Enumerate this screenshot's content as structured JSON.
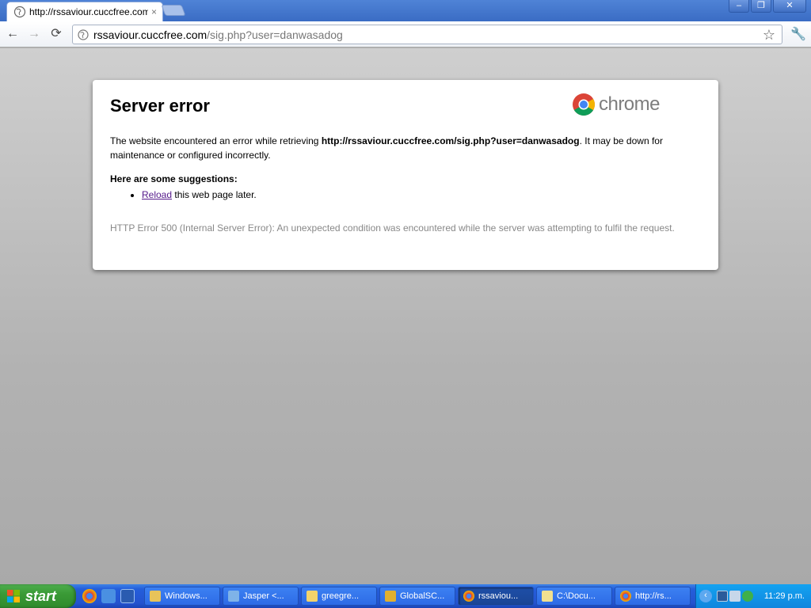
{
  "browser": {
    "tab_title": "http://rssaviour.cuccfree.com/",
    "tab_close": "×",
    "window_buttons": {
      "minimize": "–",
      "maximize": "❐",
      "close": "✕"
    }
  },
  "toolbar": {
    "back": "←",
    "forward": "→",
    "reload": "⟳",
    "url_host": "rssaviour.cuccfree.com",
    "url_path": "/sig.php?user=danwasadog",
    "star": "☆",
    "wrench": "🔧"
  },
  "error_page": {
    "title": "Server error",
    "brand": "chrome",
    "desc_prefix": "The website encountered an error while retrieving ",
    "desc_url": "http://rssaviour.cuccfree.com/sig.php?user=danwasadog",
    "desc_suffix": ". It may be down for maintenance or configured incorrectly.",
    "suggestions_heading": "Here are some suggestions:",
    "suggestion_link": "Reload",
    "suggestion_text": " this web page later.",
    "detail": "HTTP Error 500 (Internal Server Error): An unexpected condition was encountered while the server was attempting to fulfil the request."
  },
  "taskbar": {
    "start_label": "start",
    "tasks": [
      {
        "label": "Windows...",
        "color": "#e8c35a"
      },
      {
        "label": "Jasper <...",
        "color": "#7fb3e8"
      },
      {
        "label": "greegre...",
        "color": "#f2d36b"
      },
      {
        "label": "GlobalSC...",
        "color": "#e0b030"
      },
      {
        "label": "rssaviou...",
        "color": "#d94c3d"
      },
      {
        "label": "C:\\Docu...",
        "color": "#f0e090"
      },
      {
        "label": "http://rs...",
        "color": "#d94c3d"
      }
    ],
    "clock": "11:29 p.m.",
    "tray_chevron": "‹"
  }
}
